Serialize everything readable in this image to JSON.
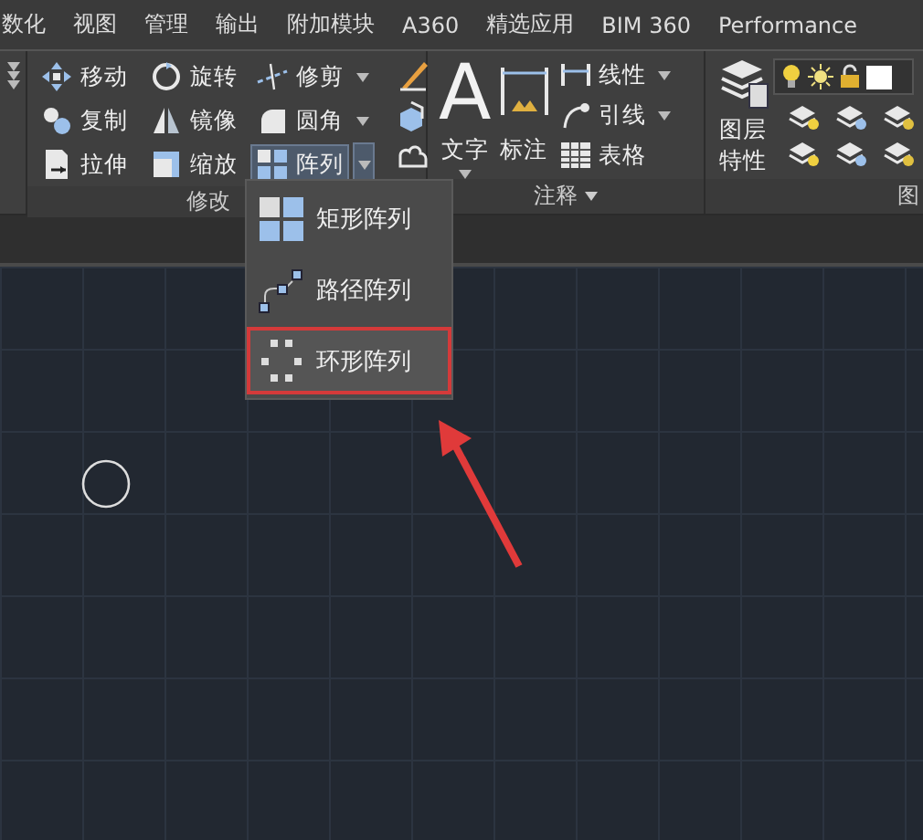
{
  "tabs": [
    {
      "label": "数化"
    },
    {
      "label": "视图"
    },
    {
      "label": "管理"
    },
    {
      "label": "输出"
    },
    {
      "label": "附加模块"
    },
    {
      "label": "A360"
    },
    {
      "label": "精选应用"
    },
    {
      "label": "BIM 360"
    },
    {
      "label": "Performance"
    }
  ],
  "modify_panel": {
    "title": "修改",
    "tools": [
      {
        "label": "移动",
        "dropdown": false,
        "pressed": false
      },
      {
        "label": "旋转",
        "dropdown": false,
        "pressed": false
      },
      {
        "label": "修剪",
        "dropdown": true,
        "pressed": false
      },
      {
        "label": "复制",
        "dropdown": false,
        "pressed": false
      },
      {
        "label": "镜像",
        "dropdown": false,
        "pressed": false
      },
      {
        "label": "圆角",
        "dropdown": true,
        "pressed": false
      },
      {
        "label": "拉伸",
        "dropdown": false,
        "pressed": false
      },
      {
        "label": "缩放",
        "dropdown": false,
        "pressed": false
      },
      {
        "label": "阵列",
        "dropdown": true,
        "pressed": true
      }
    ]
  },
  "annotation_panel": {
    "title": "注释",
    "text_tool": {
      "glyph": "A",
      "label": "文字",
      "dropdown": true
    },
    "dimension_tool": {
      "label": "标注"
    },
    "tools": [
      {
        "label": "线性",
        "dropdown": true
      },
      {
        "label": "引线",
        "dropdown": true
      },
      {
        "label": "表格",
        "dropdown": false
      }
    ]
  },
  "layers_panel": {
    "title": "图",
    "big_tool": {
      "label": "图层特性"
    }
  },
  "array_menu": [
    {
      "label": "矩形阵列",
      "selected": false
    },
    {
      "label": "路径阵列",
      "selected": false
    },
    {
      "label": "环形阵列",
      "selected": true
    }
  ]
}
